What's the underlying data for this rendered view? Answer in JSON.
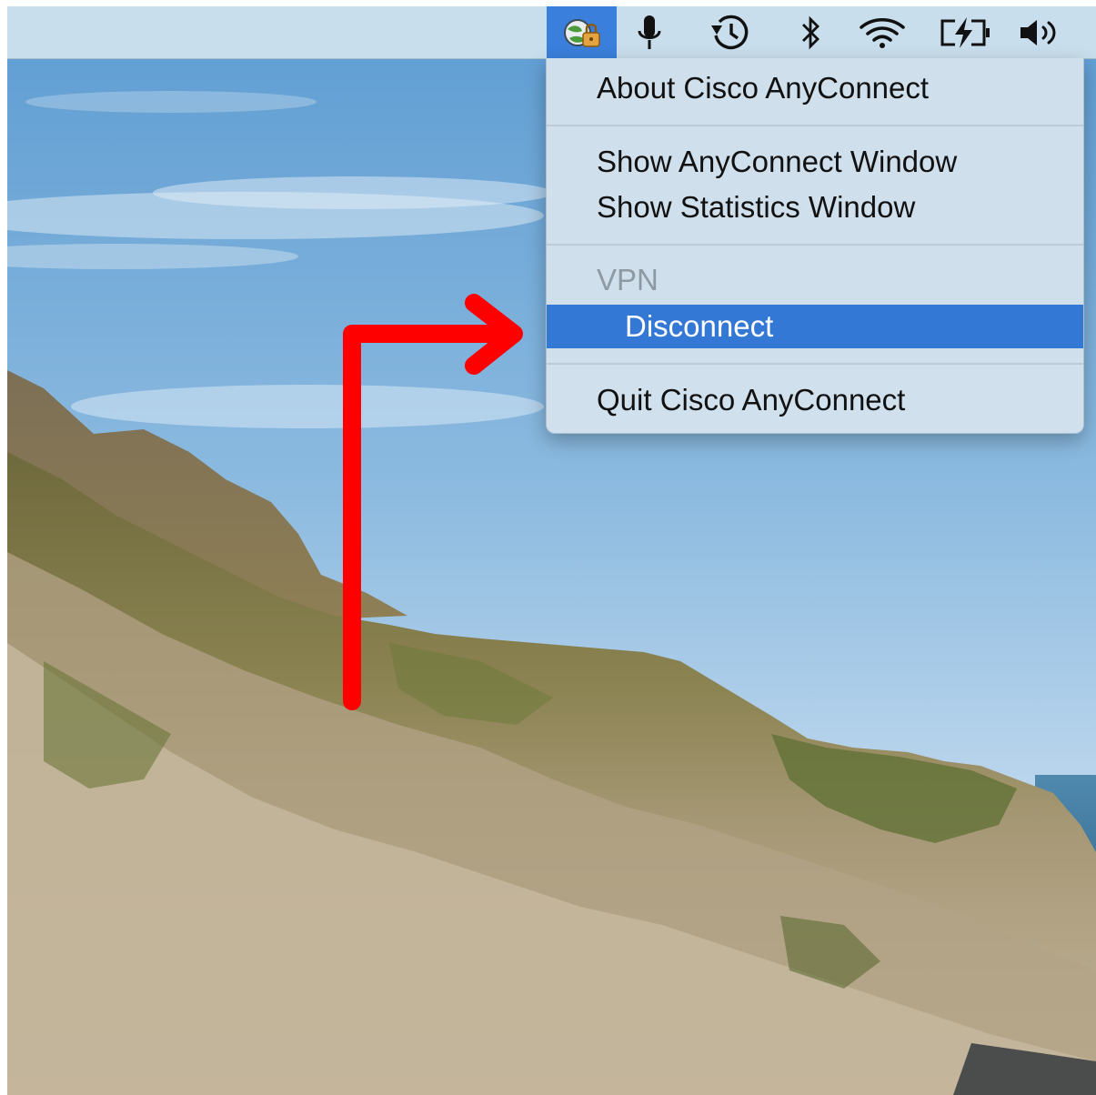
{
  "menubar": {
    "icons": [
      {
        "name": "cisco-anyconnect-icon",
        "active": true
      },
      {
        "name": "microphone-icon"
      },
      {
        "name": "time-machine-icon"
      },
      {
        "name": "bluetooth-icon"
      },
      {
        "name": "wifi-icon"
      },
      {
        "name": "battery-charging-icon"
      },
      {
        "name": "volume-icon"
      }
    ],
    "active_color": "#3a7fdb"
  },
  "menu": {
    "about": "About Cisco AnyConnect",
    "show_window": "Show AnyConnect Window",
    "show_stats": "Show Statistics Window",
    "section_header": "VPN",
    "disconnect": "Disconnect",
    "quit": "Quit Cisco AnyConnect",
    "highlight_color": "#3478d6"
  },
  "annotation": {
    "arrow_color": "#ff0000",
    "points_to": "Disconnect"
  }
}
